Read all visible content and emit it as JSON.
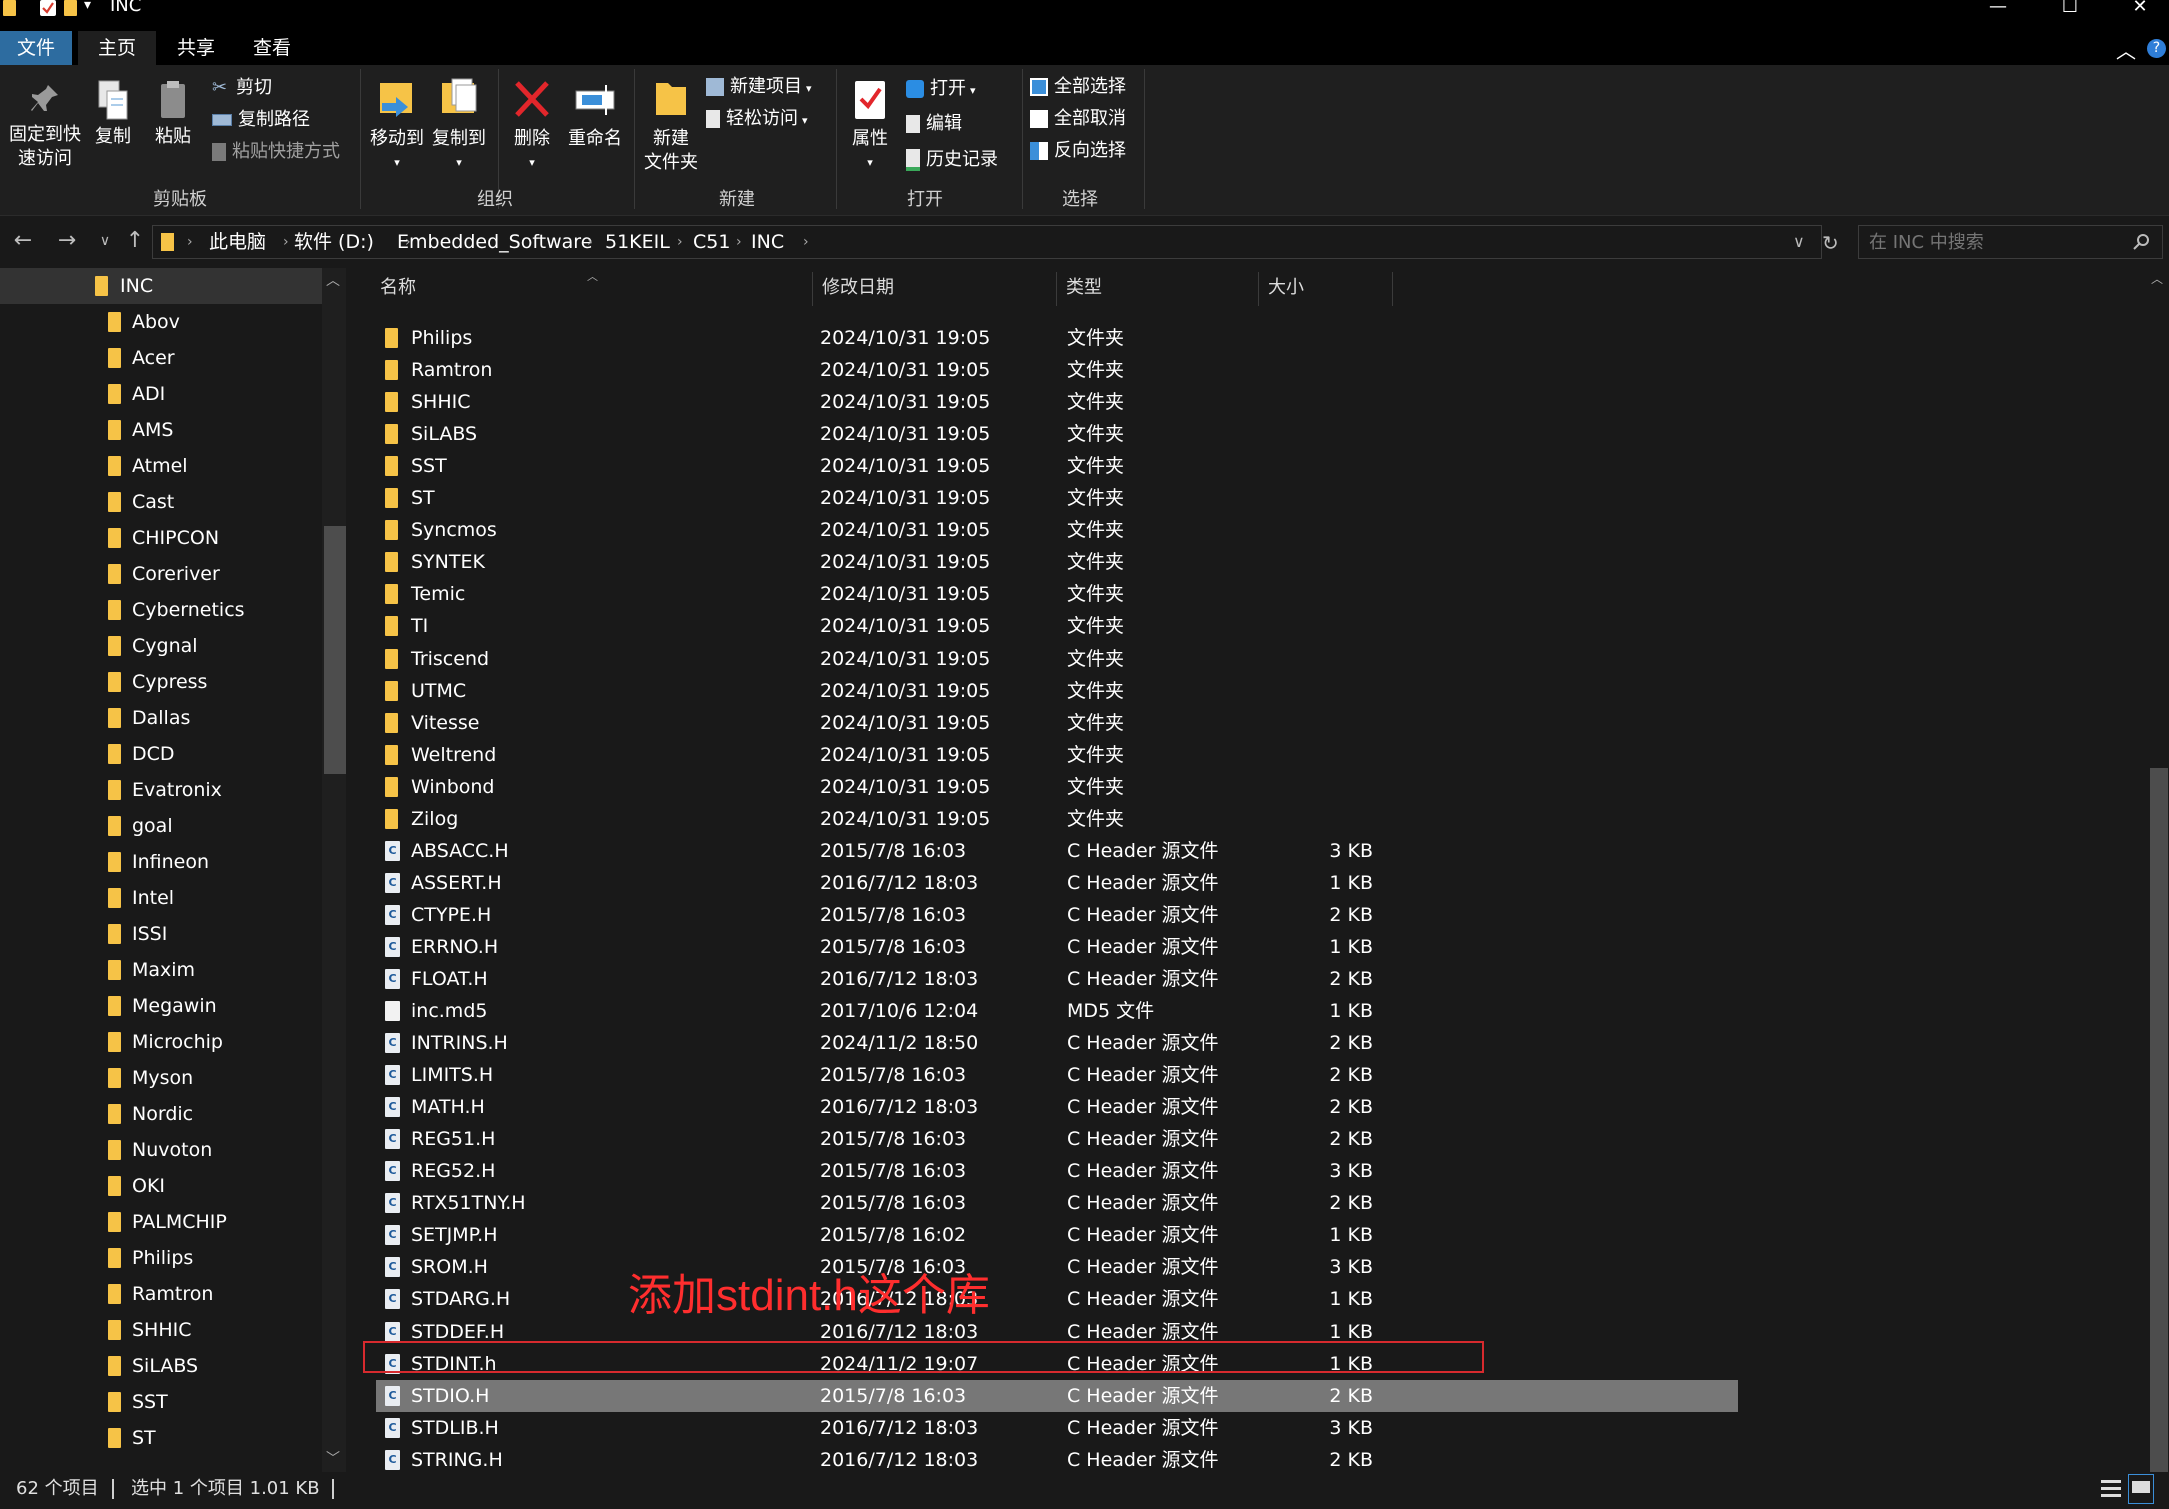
{
  "window": {
    "title": "INC",
    "controls": {
      "minimize": "—",
      "maximize": "☐",
      "close": "✕"
    }
  },
  "ribbon_tabs": [
    {
      "label": "文件"
    },
    {
      "label": "主页"
    },
    {
      "label": "共享"
    },
    {
      "label": "查看"
    }
  ],
  "ribbon": {
    "clipboard": {
      "pin": "固定到快\n速访问",
      "copy": "复制",
      "paste": "粘贴",
      "cut": "剪切",
      "copy_path": "复制路径",
      "paste_shortcut": "粘贴快捷方式",
      "group": "剪贴板"
    },
    "organize": {
      "move_to": "移动到",
      "copy_to": "复制到",
      "delete": "删除",
      "rename": "重命名",
      "group": "组织"
    },
    "new": {
      "new_folder": "新建\n文件夹",
      "new_item": "新建项目",
      "easy_access": "轻松访问",
      "group": "新建"
    },
    "open": {
      "properties": "属性",
      "open": "打开",
      "edit": "编辑",
      "history": "历史记录",
      "group": "打开"
    },
    "select": {
      "select_all": "全部选择",
      "select_none": "全部取消",
      "invert": "反向选择",
      "group": "选择"
    }
  },
  "address": {
    "crumbs": [
      "此电脑",
      "软件 (D:)",
      "Embedded_Software",
      "51KEIL",
      "C51",
      "INC"
    ],
    "search_placeholder": "在 INC 中搜索"
  },
  "nav_tree": {
    "current": "INC",
    "children": [
      "Abov",
      "Acer",
      "ADI",
      "AMS",
      "Atmel",
      "Cast",
      "CHIPCON",
      "Coreriver",
      "Cybernetics",
      "Cygnal",
      "Cypress",
      "Dallas",
      "DCD",
      "Evatronix",
      "goal",
      "Infineon",
      "Intel",
      "ISSI",
      "Maxim",
      "Megawin",
      "Microchip",
      "Myson",
      "Nordic",
      "Nuvoton",
      "OKI",
      "PALMCHIP",
      "Philips",
      "Ramtron",
      "SHHIC",
      "SiLABS",
      "SST",
      "ST"
    ]
  },
  "columns": {
    "name": "名称",
    "date": "修改日期",
    "type": "类型",
    "size": "大小"
  },
  "files": [
    {
      "name": "Philips",
      "date": "2024/10/31 19:05",
      "type": "文件夹",
      "size": "",
      "kind": "folder"
    },
    {
      "name": "Ramtron",
      "date": "2024/10/31 19:05",
      "type": "文件夹",
      "size": "",
      "kind": "folder"
    },
    {
      "name": "SHHIC",
      "date": "2024/10/31 19:05",
      "type": "文件夹",
      "size": "",
      "kind": "folder"
    },
    {
      "name": "SiLABS",
      "date": "2024/10/31 19:05",
      "type": "文件夹",
      "size": "",
      "kind": "folder"
    },
    {
      "name": "SST",
      "date": "2024/10/31 19:05",
      "type": "文件夹",
      "size": "",
      "kind": "folder"
    },
    {
      "name": "ST",
      "date": "2024/10/31 19:05",
      "type": "文件夹",
      "size": "",
      "kind": "folder"
    },
    {
      "name": "Syncmos",
      "date": "2024/10/31 19:05",
      "type": "文件夹",
      "size": "",
      "kind": "folder"
    },
    {
      "name": "SYNTEK",
      "date": "2024/10/31 19:05",
      "type": "文件夹",
      "size": "",
      "kind": "folder"
    },
    {
      "name": "Temic",
      "date": "2024/10/31 19:05",
      "type": "文件夹",
      "size": "",
      "kind": "folder"
    },
    {
      "name": "TI",
      "date": "2024/10/31 19:05",
      "type": "文件夹",
      "size": "",
      "kind": "folder"
    },
    {
      "name": "Triscend",
      "date": "2024/10/31 19:05",
      "type": "文件夹",
      "size": "",
      "kind": "folder"
    },
    {
      "name": "UTMC",
      "date": "2024/10/31 19:05",
      "type": "文件夹",
      "size": "",
      "kind": "folder"
    },
    {
      "name": "Vitesse",
      "date": "2024/10/31 19:05",
      "type": "文件夹",
      "size": "",
      "kind": "folder"
    },
    {
      "name": "Weltrend",
      "date": "2024/10/31 19:05",
      "type": "文件夹",
      "size": "",
      "kind": "folder"
    },
    {
      "name": "Winbond",
      "date": "2024/10/31 19:05",
      "type": "文件夹",
      "size": "",
      "kind": "folder"
    },
    {
      "name": "Zilog",
      "date": "2024/10/31 19:05",
      "type": "文件夹",
      "size": "",
      "kind": "folder"
    },
    {
      "name": "ABSACC.H",
      "date": "2015/7/8 16:03",
      "type": "C Header 源文件",
      "size": "3 KB",
      "kind": "header"
    },
    {
      "name": "ASSERT.H",
      "date": "2016/7/12 18:03",
      "type": "C Header 源文件",
      "size": "1 KB",
      "kind": "header"
    },
    {
      "name": "CTYPE.H",
      "date": "2015/7/8 16:03",
      "type": "C Header 源文件",
      "size": "2 KB",
      "kind": "header"
    },
    {
      "name": "ERRNO.H",
      "date": "2015/7/8 16:03",
      "type": "C Header 源文件",
      "size": "1 KB",
      "kind": "header"
    },
    {
      "name": "FLOAT.H",
      "date": "2016/7/12 18:03",
      "type": "C Header 源文件",
      "size": "2 KB",
      "kind": "header"
    },
    {
      "name": "inc.md5",
      "date": "2017/10/6 12:04",
      "type": "MD5 文件",
      "size": "1 KB",
      "kind": "plain"
    },
    {
      "name": "INTRINS.H",
      "date": "2024/11/2 18:50",
      "type": "C Header 源文件",
      "size": "2 KB",
      "kind": "header"
    },
    {
      "name": "LIMITS.H",
      "date": "2015/7/8 16:03",
      "type": "C Header 源文件",
      "size": "2 KB",
      "kind": "header"
    },
    {
      "name": "MATH.H",
      "date": "2016/7/12 18:03",
      "type": "C Header 源文件",
      "size": "2 KB",
      "kind": "header"
    },
    {
      "name": "REG51.H",
      "date": "2015/7/8 16:03",
      "type": "C Header 源文件",
      "size": "2 KB",
      "kind": "header"
    },
    {
      "name": "REG52.H",
      "date": "2015/7/8 16:03",
      "type": "C Header 源文件",
      "size": "3 KB",
      "kind": "header"
    },
    {
      "name": "RTX51TNY.H",
      "date": "2015/7/8 16:03",
      "type": "C Header 源文件",
      "size": "2 KB",
      "kind": "header"
    },
    {
      "name": "SETJMP.H",
      "date": "2015/7/8 16:02",
      "type": "C Header 源文件",
      "size": "1 KB",
      "kind": "header"
    },
    {
      "name": "SROM.H",
      "date": "2015/7/8 16:03",
      "type": "C Header 源文件",
      "size": "3 KB",
      "kind": "header"
    },
    {
      "name": "STDARG.H",
      "date": "2016/7/12 18:03",
      "type": "C Header 源文件",
      "size": "1 KB",
      "kind": "header"
    },
    {
      "name": "STDDEF.H",
      "date": "2016/7/12 18:03",
      "type": "C Header 源文件",
      "size": "1 KB",
      "kind": "header"
    },
    {
      "name": "STDINT.h",
      "date": "2024/11/2 19:07",
      "type": "C Header 源文件",
      "size": "1 KB",
      "kind": "header"
    },
    {
      "name": "STDIO.H",
      "date": "2015/7/8 16:03",
      "type": "C Header 源文件",
      "size": "2 KB",
      "kind": "header",
      "selected": true
    },
    {
      "name": "STDLIB.H",
      "date": "2016/7/12 18:03",
      "type": "C Header 源文件",
      "size": "3 KB",
      "kind": "header"
    },
    {
      "name": "STRING.H",
      "date": "2016/7/12 18:03",
      "type": "C Header 源文件",
      "size": "2 KB",
      "kind": "header"
    }
  ],
  "annotation": "添加stdint.h这个库",
  "status": {
    "count": "62 个项目",
    "selection": "选中 1 个项目  1.01 KB"
  },
  "colors": {
    "accent": "#2d6ca0",
    "folder": "#f6c347",
    "annotation": "#ff2e2e"
  }
}
